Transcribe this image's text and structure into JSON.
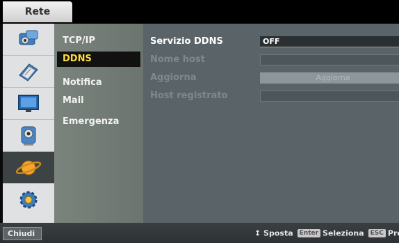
{
  "window": {
    "tab_title": "Rete"
  },
  "sidebar_icons": [
    {
      "name": "network-camera-icon",
      "selected": false
    },
    {
      "name": "disk-icon",
      "selected": false
    },
    {
      "name": "monitor-icon",
      "selected": false
    },
    {
      "name": "camera-record-icon",
      "selected": false
    },
    {
      "name": "network-globe-icon",
      "selected": true
    },
    {
      "name": "system-gear-icon",
      "selected": false
    }
  ],
  "submenu": {
    "items": [
      "TCP/IP",
      "DDNS",
      "Notifica",
      "Mail",
      "Emergenza"
    ],
    "active": "DDNS"
  },
  "settings": {
    "ddns_service": {
      "label": "Servizio DDNS",
      "value": "OFF"
    },
    "host_name": {
      "label": "Nome host",
      "value": ""
    },
    "update": {
      "label": "Aggiorna",
      "button_label": "Aggiorna"
    },
    "registered_host": {
      "label": "Host registrato",
      "value": ""
    }
  },
  "footer": {
    "close_label": "Chiudi",
    "move_hint": "↕ Sposta",
    "enter_key": "Enter",
    "select_hint": "Seleziona",
    "esc_key": "ESC",
    "prev_hint": "Prec"
  },
  "colors": {
    "active_text": "#ffdc3c",
    "content_bg": "#5a6468",
    "submenu_bg": "#7a847d"
  }
}
